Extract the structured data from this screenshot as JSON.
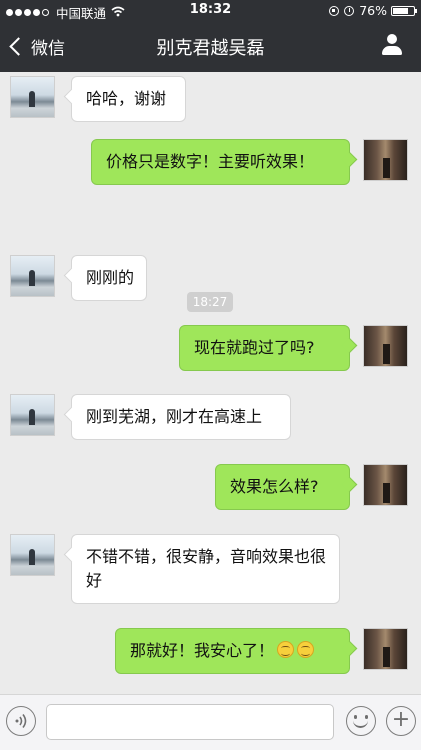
{
  "status_bar": {
    "carrier": "中国联通",
    "time": "18:32",
    "battery_text": "76%",
    "battery_level": 0.76,
    "signal_bars_filled": 4,
    "signal_bars_total": 5
  },
  "nav": {
    "back_label": "微信",
    "title": "别克君越吴磊",
    "right_icon": "person-icon"
  },
  "chat": {
    "time_separator": "18:27",
    "messages": [
      {
        "from": "friend",
        "text": "哈哈，谢谢"
      },
      {
        "from": "me",
        "text": "价格只是数字！主要听效果！"
      },
      {
        "from": "friend",
        "text": "刚刚的"
      },
      {
        "from": "me",
        "text": "现在就跑过了吗?"
      },
      {
        "from": "friend",
        "text": "刚到芜湖，刚才在高速上"
      },
      {
        "from": "me",
        "text": "效果怎么样?"
      },
      {
        "from": "friend",
        "text": "不错不错，很安静，音响效果也很好"
      },
      {
        "from": "me",
        "text": "那就好！我安心了！",
        "emoji": [
          "smile-emoji",
          "smile-emoji"
        ]
      }
    ]
  },
  "input_bar": {
    "voice_icon": "voice-icon",
    "text_value": "",
    "emoji_icon": "emoji-icon",
    "plus_icon": "plus-icon"
  },
  "colors": {
    "topbar": "#2f3135",
    "background": "#ebebeb",
    "outgoing_bubble": "#9fe65a",
    "incoming_bubble": "#ffffff"
  }
}
